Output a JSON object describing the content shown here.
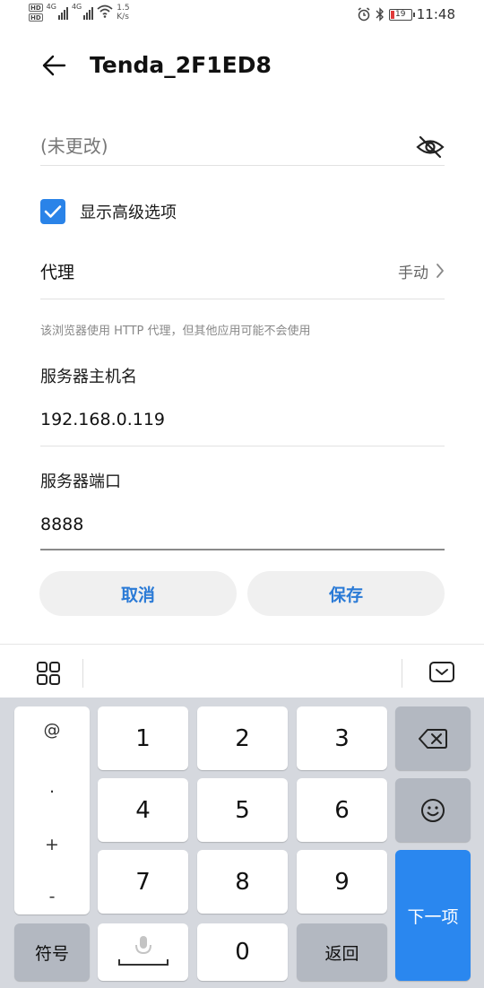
{
  "status_bar": {
    "hd1": "HD",
    "hd2": "HD",
    "sig1_type": "4G",
    "sig2_type": "4G",
    "net_speed_value": "1.5",
    "net_speed_unit": "K/s",
    "battery": "19",
    "time": "11:48",
    "icons": [
      "alarm-icon",
      "bluetooth-icon",
      "battery-icon",
      "wifi-icon",
      "signal-icon"
    ]
  },
  "header": {
    "title": "Tenda_2F1ED8"
  },
  "form": {
    "password_value": "(未更改)",
    "show_advanced_label": "显示高级选项",
    "show_advanced_checked": true,
    "proxy_label": "代理",
    "proxy_value": "手动",
    "proxy_hint": "该浏览器使用 HTTP 代理，但其他应用可能不会使用",
    "hostname_label": "服务器主机名",
    "hostname_value": "192.168.0.119",
    "port_label": "服务器端口",
    "port_value": "8888"
  },
  "buttons": {
    "cancel": "取消",
    "save": "保存"
  },
  "keyboard": {
    "symbols": [
      "@",
      ".",
      "+",
      "-"
    ],
    "symbols_key": "符号",
    "digits": [
      "1",
      "2",
      "3",
      "4",
      "5",
      "6",
      "7",
      "8",
      "9",
      "0"
    ],
    "return_key": "返回",
    "next_key": "下一项"
  },
  "colors": {
    "accent": "#2a83e8",
    "button_text": "#2a7ad6",
    "keyboard_bg": "#d5d8de",
    "func_key": "#b3b8c1",
    "next_key": "#2a87ef"
  }
}
